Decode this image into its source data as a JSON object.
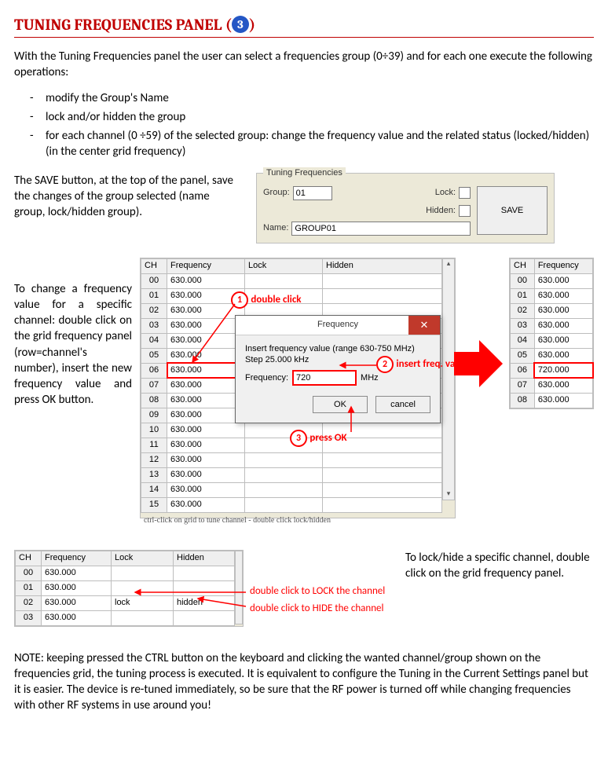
{
  "title_prefix": "TUNING FREQUENCIES PANEL (",
  "title_badge": "3",
  "title_suffix": ")",
  "intro": "With the Tuning Frequencies panel the user can select a frequencies group (0÷39) and for each one execute the following operations:",
  "bullets": [
    "modify the Group's Name",
    "lock and/or hidden the group",
    "for each channel (0 ÷59) of the selected group: change the frequency value and the related status (locked/hidden) (in the center grid frequency)"
  ],
  "save_para": "The SAVE button, at the top of the panel, save the changes of the group selected (name group, lock/hidden group).",
  "panel": {
    "groupbox_title": "Tuning Frequencies",
    "group_label": "Group:",
    "group_value": "01",
    "lock_label": "Lock:",
    "hidden_label": "Hidden:",
    "name_label": "Name:",
    "name_value": "GROUP01",
    "save_btn": "SAVE"
  },
  "change_para": "To change a frequency value for a specific channel: double click on the grid frequency panel (row=channel's number), insert the new frequency value and press OK button.",
  "grid": {
    "headers": [
      "CH",
      "Frequency",
      "Lock",
      "Hidden"
    ],
    "rows": [
      {
        "ch": "00",
        "freq": "630.000",
        "lock": "",
        "hidden": ""
      },
      {
        "ch": "01",
        "freq": "630.000",
        "lock": "",
        "hidden": ""
      },
      {
        "ch": "02",
        "freq": "630.000",
        "lock": "",
        "hidden": ""
      },
      {
        "ch": "03",
        "freq": "630.000",
        "lock": "",
        "hidden": ""
      },
      {
        "ch": "04",
        "freq": "630.000",
        "lock": "",
        "hidden": ""
      },
      {
        "ch": "05",
        "freq": "630.000",
        "lock": "",
        "hidden": ""
      },
      {
        "ch": "06",
        "freq": "630.000",
        "lock": "",
        "hidden": ""
      },
      {
        "ch": "07",
        "freq": "630.000",
        "lock": "",
        "hidden": ""
      },
      {
        "ch": "08",
        "freq": "630.000",
        "lock": "",
        "hidden": ""
      },
      {
        "ch": "09",
        "freq": "630.000",
        "lock": "",
        "hidden": ""
      },
      {
        "ch": "10",
        "freq": "630.000",
        "lock": "",
        "hidden": ""
      },
      {
        "ch": "11",
        "freq": "630.000",
        "lock": "",
        "hidden": ""
      },
      {
        "ch": "12",
        "freq": "630.000",
        "lock": "",
        "hidden": ""
      },
      {
        "ch": "13",
        "freq": "630.000",
        "lock": "",
        "hidden": ""
      },
      {
        "ch": "14",
        "freq": "630.000",
        "lock": "",
        "hidden": ""
      },
      {
        "ch": "15",
        "freq": "630.000",
        "lock": "",
        "hidden": ""
      }
    ],
    "hint": "ctrl-click on grid to tune channel - double click lock/hidden"
  },
  "dialog": {
    "title": "Frequency",
    "line1": "Insert frequency value (range 630-750 MHz)",
    "line2": "Step 25.000 kHz",
    "freq_label": "Frequency:",
    "freq_value": "720",
    "unit": "MHz",
    "ok": "OK",
    "cancel": "cancel"
  },
  "annot": {
    "n1": "1",
    "n1_label": "double click",
    "n2": "2",
    "n2_label": "insert freq. value",
    "n3": "3",
    "n3_label": "press OK"
  },
  "grid_after": {
    "headers": [
      "CH",
      "Frequency"
    ],
    "rows": [
      {
        "ch": "00",
        "freq": "630.000"
      },
      {
        "ch": "01",
        "freq": "630.000"
      },
      {
        "ch": "02",
        "freq": "630.000"
      },
      {
        "ch": "03",
        "freq": "630.000"
      },
      {
        "ch": "04",
        "freq": "630.000"
      },
      {
        "ch": "05",
        "freq": "630.000"
      },
      {
        "ch": "06",
        "freq": "720.000"
      },
      {
        "ch": "07",
        "freq": "630.000"
      },
      {
        "ch": "08",
        "freq": "630.000"
      }
    ]
  },
  "lockhide_para": "To lock/hide a specific channel, double click on the grid frequency panel.",
  "grid_lock": {
    "headers": [
      "CH",
      "Frequency",
      "Lock",
      "Hidden"
    ],
    "rows": [
      {
        "ch": "00",
        "freq": "630.000",
        "lock": "",
        "hidden": ""
      },
      {
        "ch": "01",
        "freq": "630.000",
        "lock": "",
        "hidden": ""
      },
      {
        "ch": "02",
        "freq": "630.000",
        "lock": "lock",
        "hidden": "hidden"
      },
      {
        "ch": "03",
        "freq": "630.000",
        "lock": "",
        "hidden": ""
      }
    ]
  },
  "annot_lock": {
    "lock_text": "double click to LOCK the channel",
    "hide_text": "double click to HIDE the channel"
  },
  "note": "NOTE: keeping pressed the CTRL button on the keyboard and clicking the wanted channel/group shown on the frequencies grid, the tuning process is executed. It is equivalent to configure the Tuning in the Current Settings panel but it is easier.  The device is re-tuned immediately, so be sure that the RF power is turned off while changing frequencies with other RF systems in use around you!"
}
